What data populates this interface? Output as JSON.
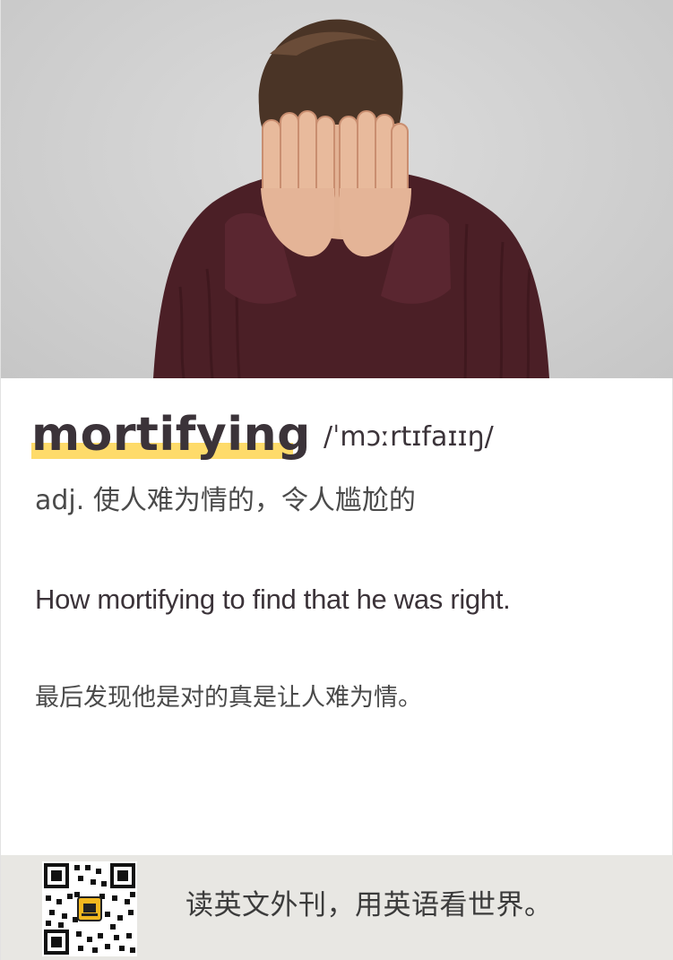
{
  "entry": {
    "word": "mortifying",
    "phonetic": "/ˈmɔːrtɪfaɪɪŋ/",
    "definition": "adj. 使人难为情的，令人尴尬的",
    "example_en": "How mortifying to find that he was right.",
    "example_zh": "最后发现他是对的真是让人难为情。"
  },
  "footer": {
    "slogan": "读英文外刊，用英语看世界。"
  },
  "colors": {
    "word_text": "#3b3339",
    "highlight": "#fedb6a",
    "footer_bg": "#e8e7e3",
    "sweater": "#4b1f26"
  },
  "icons": {
    "qr": "qr-code-icon"
  }
}
